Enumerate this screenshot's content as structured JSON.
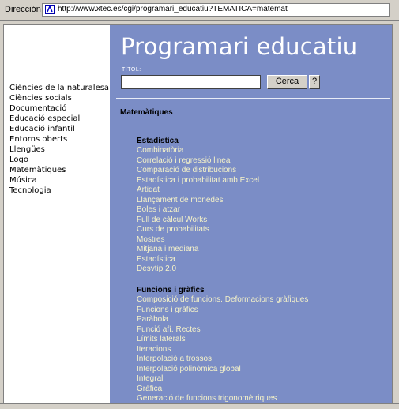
{
  "addressbar": {
    "label": "Dirección",
    "url": "http://www.xtec.es/cgi/programari_educatiu?TEMATICA=matemat"
  },
  "sidebar": {
    "items": [
      {
        "label": "Ciències de la naturalesa"
      },
      {
        "label": "Ciències socials"
      },
      {
        "label": "Documentació"
      },
      {
        "label": "Educació especial"
      },
      {
        "label": "Educació infantil"
      },
      {
        "label": "Entorns oberts"
      },
      {
        "label": "Llengües"
      },
      {
        "label": "Logo"
      },
      {
        "label": "Matemàtiques"
      },
      {
        "label": "Música"
      },
      {
        "label": "Tecnologia"
      }
    ]
  },
  "main": {
    "title": "Programari educatiu",
    "search_label": "TÍTOL:",
    "search_value": "",
    "search_button": "Cerca",
    "help_button": "?",
    "section": "Matemàtiques",
    "categories": [
      {
        "name": "Estadística",
        "items": [
          "Combinatòria",
          "Correlació i regressió lineal",
          "Comparació de distribucions",
          "Estadística i probabilitat amb Excel",
          "Artidat",
          "Llançament de monedes",
          "Boles i atzar",
          "Full de càlcul Works",
          "Curs de probabilitats",
          "Mostres",
          "Mitjana i mediana",
          "Estadística",
          "Desvtip 2.0"
        ]
      },
      {
        "name": "Funcions i gràfics",
        "items": [
          "Composició de funcions. Deformacions gràfiques",
          "Funcions i gràfics",
          "Paràbola",
          "Funció afí. Rectes",
          "Límits laterals",
          "Iteracions",
          "Interpolació a trossos",
          "Interpolació polinòmica global",
          "Integral",
          "Gràfica",
          "Generació de funcions trigonomètriques"
        ]
      }
    ]
  },
  "colors": {
    "main_bg": "#7b8dc6",
    "link": "#f6f3c8"
  }
}
